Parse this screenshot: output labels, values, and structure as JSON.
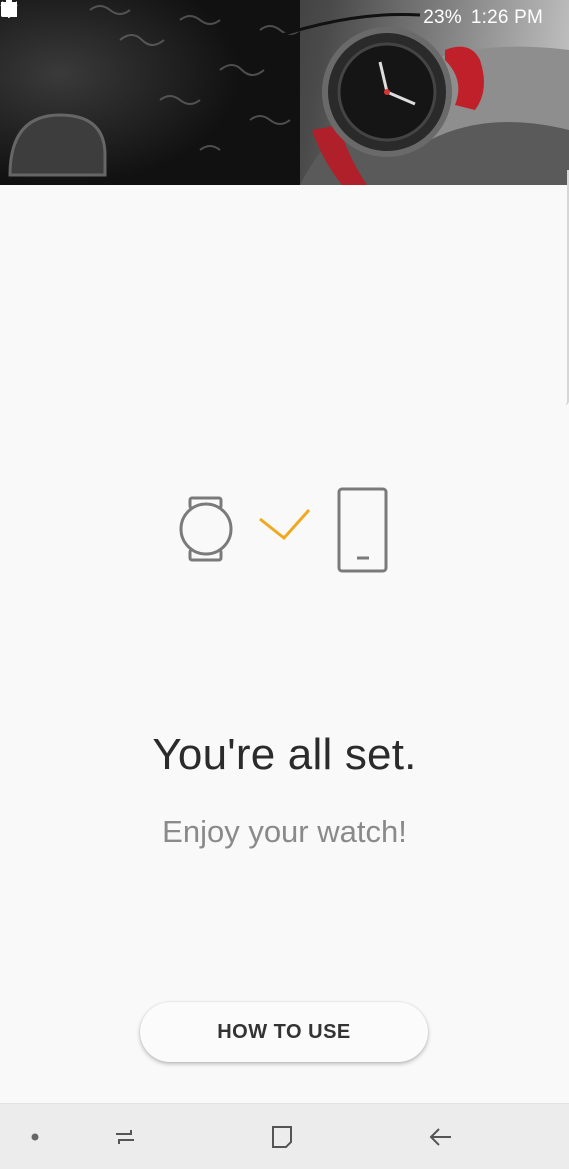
{
  "status_bar": {
    "battery": "23%",
    "time": "1:26 PM",
    "icons": [
      "gallery-icon",
      "battery-saver-icon",
      "bluetooth-icon",
      "mute-icon",
      "wifi-icon",
      "signal-icon",
      "battery-icon"
    ]
  },
  "main": {
    "title": "You're all set.",
    "subtitle": "Enjoy your watch!",
    "how_to_use_label": "HOW TO USE"
  },
  "illustration": {
    "icons": [
      "watch-icon",
      "checkmark-icon",
      "phone-icon"
    ],
    "check_color": "#f0a81e",
    "outline_color": "#7a7a7a"
  },
  "nav_bar": {
    "icons": [
      "dot-icon",
      "recents-icon",
      "home-icon",
      "back-icon"
    ]
  }
}
